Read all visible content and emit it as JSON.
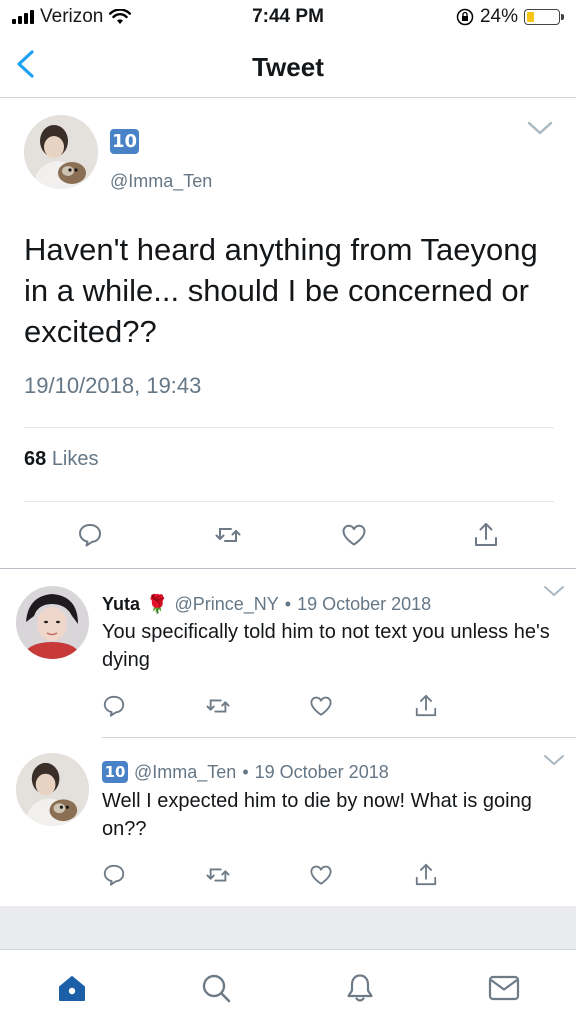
{
  "status_bar": {
    "carrier": "Verizon",
    "time": "7:44 PM",
    "battery": "24%",
    "battery_level": 0.24
  },
  "nav": {
    "title": "Tweet"
  },
  "main_tweet": {
    "badge_emoji": "10",
    "handle": "@Imma_Ten",
    "text": "Haven't heard anything from Taeyong in a while... should I be concerned or excited??",
    "timestamp": "19/10/2018, 19:43",
    "likes_count": "68",
    "likes_label": "Likes"
  },
  "replies": [
    {
      "name": "Yuta",
      "emoji": "🌹",
      "handle": "@Prince_NY",
      "separator": "•",
      "date": "19 October 2018",
      "text": "You specifically told him to not text you unless he's dying"
    },
    {
      "badge_emoji": "10",
      "handle": "@Imma_Ten",
      "separator": "•",
      "date": "19 October 2018",
      "text": "Well I expected him to die by now! What is going on??"
    }
  ],
  "colors": {
    "accent": "#1da1f2",
    "tab_active": "#1b5fa8",
    "muted": "#657786",
    "icon": "#6e7b87"
  },
  "icons": {
    "reply": "speech-bubble-icon",
    "retweet": "retweet-icon",
    "like": "heart-icon",
    "share": "share-icon",
    "home": "home-icon",
    "search": "search-icon",
    "notifications": "bell-icon",
    "messages": "envelope-icon"
  }
}
